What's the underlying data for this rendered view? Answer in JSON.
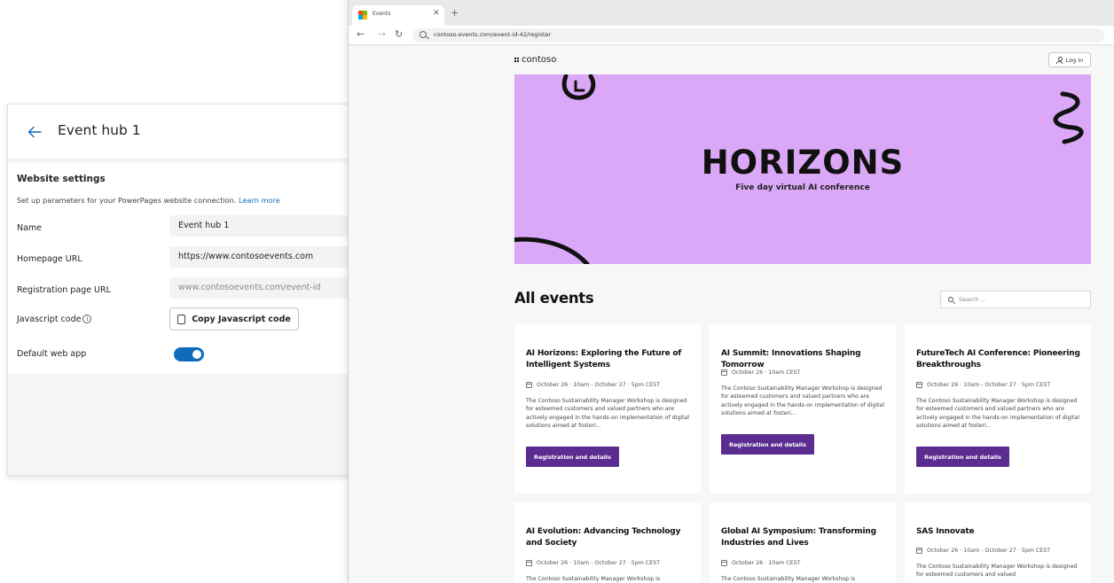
{
  "settings_panel": {
    "title": "Event hub 1",
    "section_title": "Website settings",
    "description": "Set up parameters for your PowerPages website connection.",
    "learn_more": "Learn more",
    "fields": {
      "name_label": "Name",
      "name_value": "Event hub 1",
      "homepage_label": "Homepage URL",
      "homepage_value": "https://www.contosoevents.com",
      "registration_label": "Registration page URL",
      "registration_placeholder": "www.contosoevents.com/event-id",
      "javascript_label": "Javascript code",
      "copy_button": "Copy Javascript code",
      "default_web_app_label": "Default web app",
      "default_web_app_on": true
    },
    "accent_color": "#0f6cbd"
  },
  "browser": {
    "tab_title": "Events",
    "url": "contoso.events.com/event-id-42/register"
  },
  "site": {
    "logo_text": "contoso",
    "login_label": "Log in",
    "hero": {
      "title": "HORIZONS",
      "subtitle": "Five day virtual AI conference",
      "background": "#dba8f7"
    },
    "section_title": "All events",
    "search_placeholder": "Search ...",
    "button_color": "#5c2d91",
    "events": [
      {
        "title": "AI Horizons: Exploring the Future of Intelligent Systems",
        "date": "October 26 · 10am - October 27 · 5pm CEST",
        "description": "The Contoso Sustainability Manager Workshop is designed for esteemed customers and valued partners who are actively engaged in the hands-on implementation of digital solutions aimed at fosteri...",
        "button": "Registration and details"
      },
      {
        "title": "AI Summit: Innovations Shaping Tomorrow",
        "date": "October 26 · 10am CEST",
        "description": "The Contoso Sustainability Manager Workshop is designed for esteemed customers and valued partners who are actively engaged in the hands-on implementation of digital solutions aimed at fosteri...",
        "button": "Registration and details"
      },
      {
        "title": "FutureTech AI Conference: Pioneering Breakthroughs",
        "date": "October 26 · 10am - October 27 · 5pm CEST",
        "description": "The Contoso Sustainability Manager Workshop is designed for esteemed customers and valued partners who are actively engaged in the hands-on implementation of digital solutions aimed at fosteri...",
        "button": "Registration and details"
      },
      {
        "title": "AI Evolution: Advancing Technology and Society",
        "date": "October 26 · 10am - October 27 · 5pm CEST",
        "description": "The Contoso Sustainability Manager Workshop is",
        "button": ""
      },
      {
        "title": "Global AI Symposium: Transforming Industries and Lives",
        "date": "October 26 · 10am CEST",
        "description": "The Contoso Sustainability Manager Workshop is",
        "button": ""
      },
      {
        "title": "SAS Innovate",
        "date": "October 26 · 10am - October 27 · 5pm CEST",
        "description": "The Contoso Sustainability Manager Workshop is designed for esteemed customers and valued",
        "button": ""
      }
    ]
  }
}
